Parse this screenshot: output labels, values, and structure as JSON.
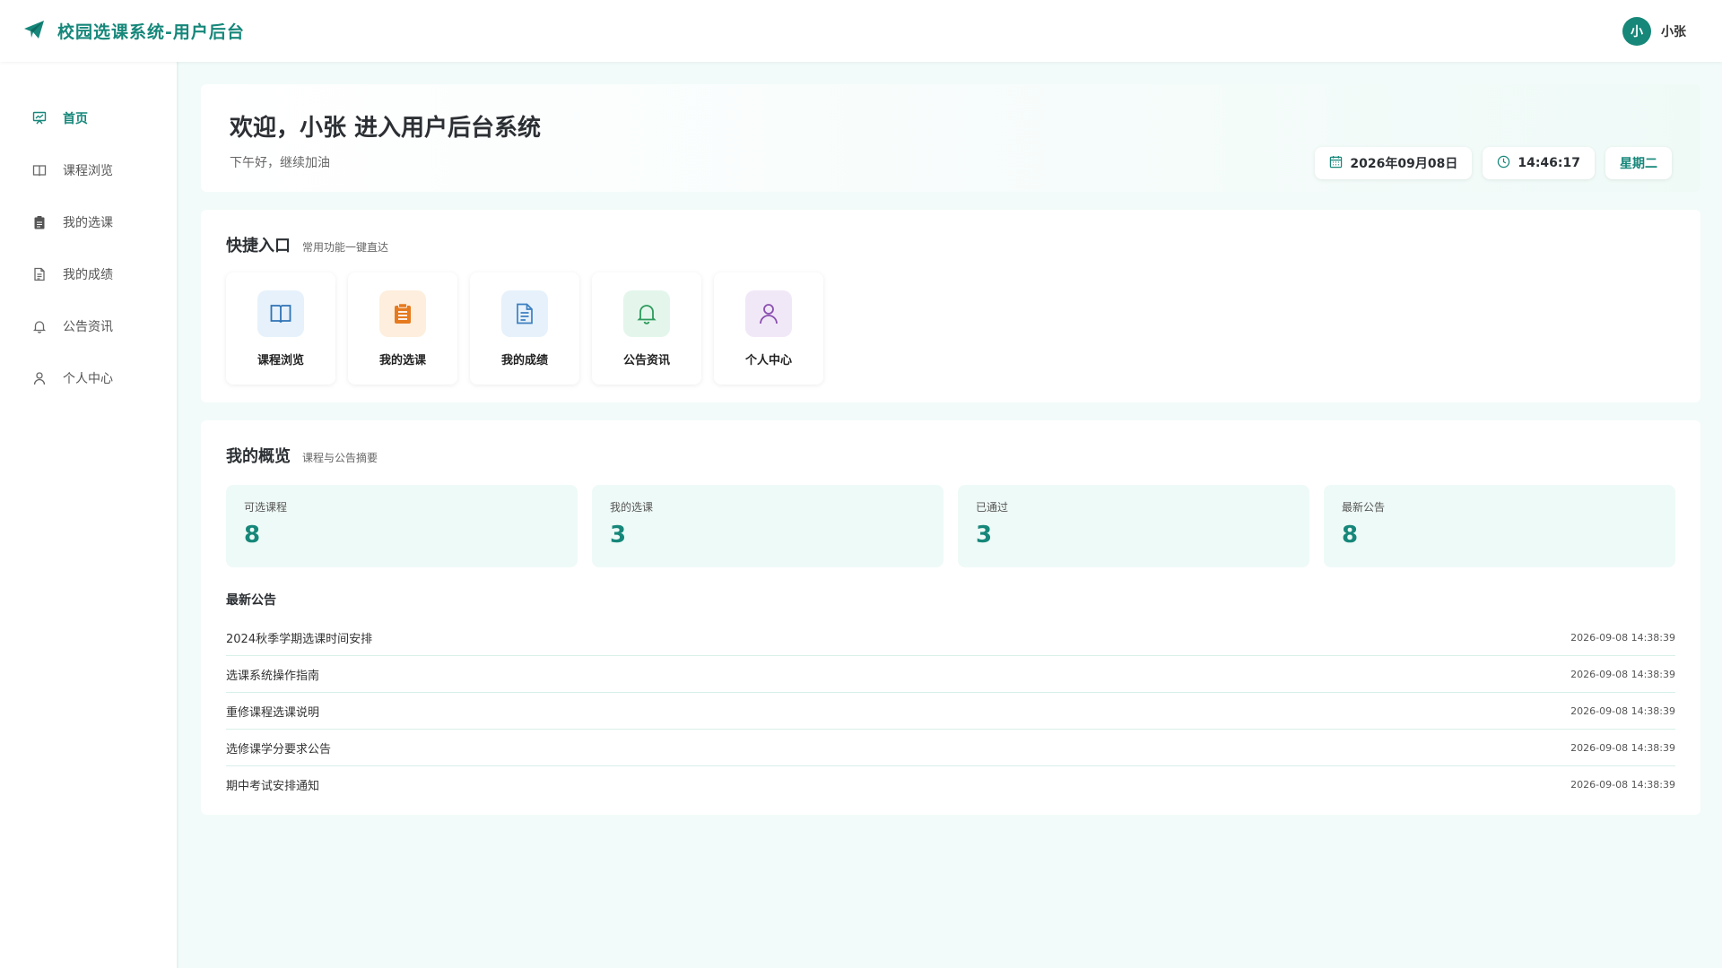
{
  "header": {
    "title": "校园选课系统-用户后台",
    "avatar_letter": "小",
    "user_name": "小张"
  },
  "sidebar": {
    "items": [
      {
        "label": "首页",
        "icon": "dashboard-icon",
        "active": true
      },
      {
        "label": "课程浏览",
        "icon": "book-icon"
      },
      {
        "label": "我的选课",
        "icon": "clipboard-icon"
      },
      {
        "label": "我的成绩",
        "icon": "document-icon"
      },
      {
        "label": "公告资讯",
        "icon": "bell-icon"
      },
      {
        "label": "个人中心",
        "icon": "user-icon"
      }
    ]
  },
  "welcome": {
    "title": "欢迎，小张 进入用户后台系统",
    "subtitle": "下午好，继续加油",
    "date": "2026年09月08日",
    "time": "14:46:17",
    "weekday": "星期二"
  },
  "quick": {
    "title": "快捷入口",
    "subtitle": "常用功能一键直达",
    "items": [
      {
        "label": "课程浏览",
        "icon": "book-icon",
        "bg": "#e6f1fb",
        "color": "#2f73b5"
      },
      {
        "label": "我的选课",
        "icon": "clipboard-icon",
        "bg": "#fdeedd",
        "color": "#e67a1f"
      },
      {
        "label": "我的成绩",
        "icon": "document-icon",
        "bg": "#e6f1fb",
        "color": "#3c7fc0"
      },
      {
        "label": "公告资讯",
        "icon": "bell-icon",
        "bg": "#e4f6ec",
        "color": "#2e9a5c"
      },
      {
        "label": "个人中心",
        "icon": "user-icon",
        "bg": "#f1e8f7",
        "color": "#8a4fb0"
      }
    ]
  },
  "overview": {
    "title": "我的概览",
    "subtitle": "课程与公告摘要",
    "stats": [
      {
        "label": "可选课程",
        "value": "8"
      },
      {
        "label": "我的选课",
        "value": "3"
      },
      {
        "label": "已通过",
        "value": "3"
      },
      {
        "label": "最新公告",
        "value": "8"
      }
    ],
    "announcements_title": "最新公告",
    "announcements": [
      {
        "title": "2024秋季学期选课时间安排",
        "time": "2026-09-08 14:38:39"
      },
      {
        "title": "选课系统操作指南",
        "time": "2026-09-08 14:38:39"
      },
      {
        "title": "重修课程选课说明",
        "time": "2026-09-08 14:38:39"
      },
      {
        "title": "选修课学分要求公告",
        "time": "2026-09-08 14:38:39"
      },
      {
        "title": "期中考试安排通知",
        "time": "2026-09-08 14:38:39"
      }
    ]
  },
  "colors": {
    "accent": "#16877a",
    "background": "#f2fbf9",
    "stat_bg": "#eefaf7"
  }
}
